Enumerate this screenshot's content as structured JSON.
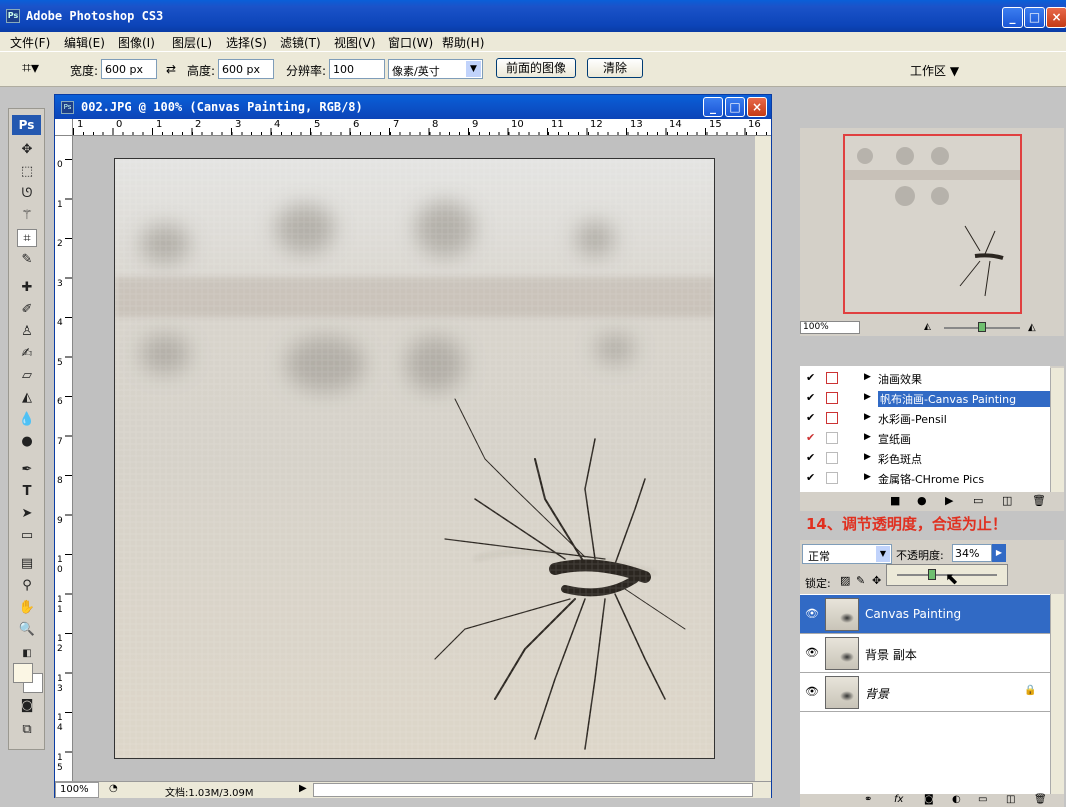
{
  "app": {
    "title": "Adobe Photoshop CS3"
  },
  "menu": [
    "文件(F)",
    "编辑(E)",
    "图像(I)",
    "图层(L)",
    "选择(S)",
    "滤镜(T)",
    "视图(V)",
    "窗口(W)",
    "帮助(H)"
  ],
  "options": {
    "width_label": "宽度:",
    "width_value": "600 px",
    "height_label": "高度:",
    "height_value": "600 px",
    "res_label": "分辨率:",
    "res_value": "100",
    "unit": "像素/英寸",
    "front_image_btn": "前面的图像",
    "clear_btn": "清除",
    "workspace": "工作区 ▼"
  },
  "document": {
    "title": "002.JPG @ 100% (Canvas Painting, RGB/8)",
    "zoom": "100%",
    "doc_size": "文档:1.03M/3.09M"
  },
  "ruler_h": [
    "1",
    "0",
    "1",
    "2",
    "3",
    "4",
    "5",
    "6",
    "7",
    "8",
    "9",
    "10",
    "11",
    "12",
    "13",
    "14",
    "15",
    "16"
  ],
  "ruler_v": [
    "0",
    "1",
    "2",
    "3",
    "4",
    "5",
    "6",
    "7",
    "8",
    "9",
    "1 0",
    "1 1",
    "1 2",
    "1 3",
    "1 4",
    "1 5"
  ],
  "navigator": {
    "zoom": "100%"
  },
  "actions": [
    {
      "name": "油画效果",
      "check": true,
      "dialog": true,
      "selected": false
    },
    {
      "name": "帆布油画-Canvas Painting",
      "check": true,
      "dialog": true,
      "selected": true
    },
    {
      "name": "水彩画-Pensil",
      "check": true,
      "dialog": true,
      "selected": false
    },
    {
      "name": "宣纸画",
      "check": true,
      "dialog": false,
      "selected": false
    },
    {
      "name": "彩色斑点",
      "check": true,
      "dialog": false,
      "selected": false
    },
    {
      "name": "金属铬-CHrome Pics",
      "check": true,
      "dialog": false,
      "selected": false
    }
  ],
  "annotation": "14、调节透明度，合适为止！",
  "layers_panel": {
    "blend_mode": "正常",
    "opacity_label": "不透明度:",
    "opacity_value": "34%",
    "lock_label": "锁定:"
  },
  "layers": [
    {
      "name": "Canvas Painting",
      "selected": true,
      "locked": false,
      "italic": false
    },
    {
      "name": "背景 副本",
      "selected": false,
      "locked": false,
      "italic": false
    },
    {
      "name": "背景",
      "selected": false,
      "locked": true,
      "italic": true
    }
  ],
  "colors": {
    "title_blue": "#0c44b8",
    "selection": "#316ac5",
    "annotation_red": "#e03020"
  }
}
